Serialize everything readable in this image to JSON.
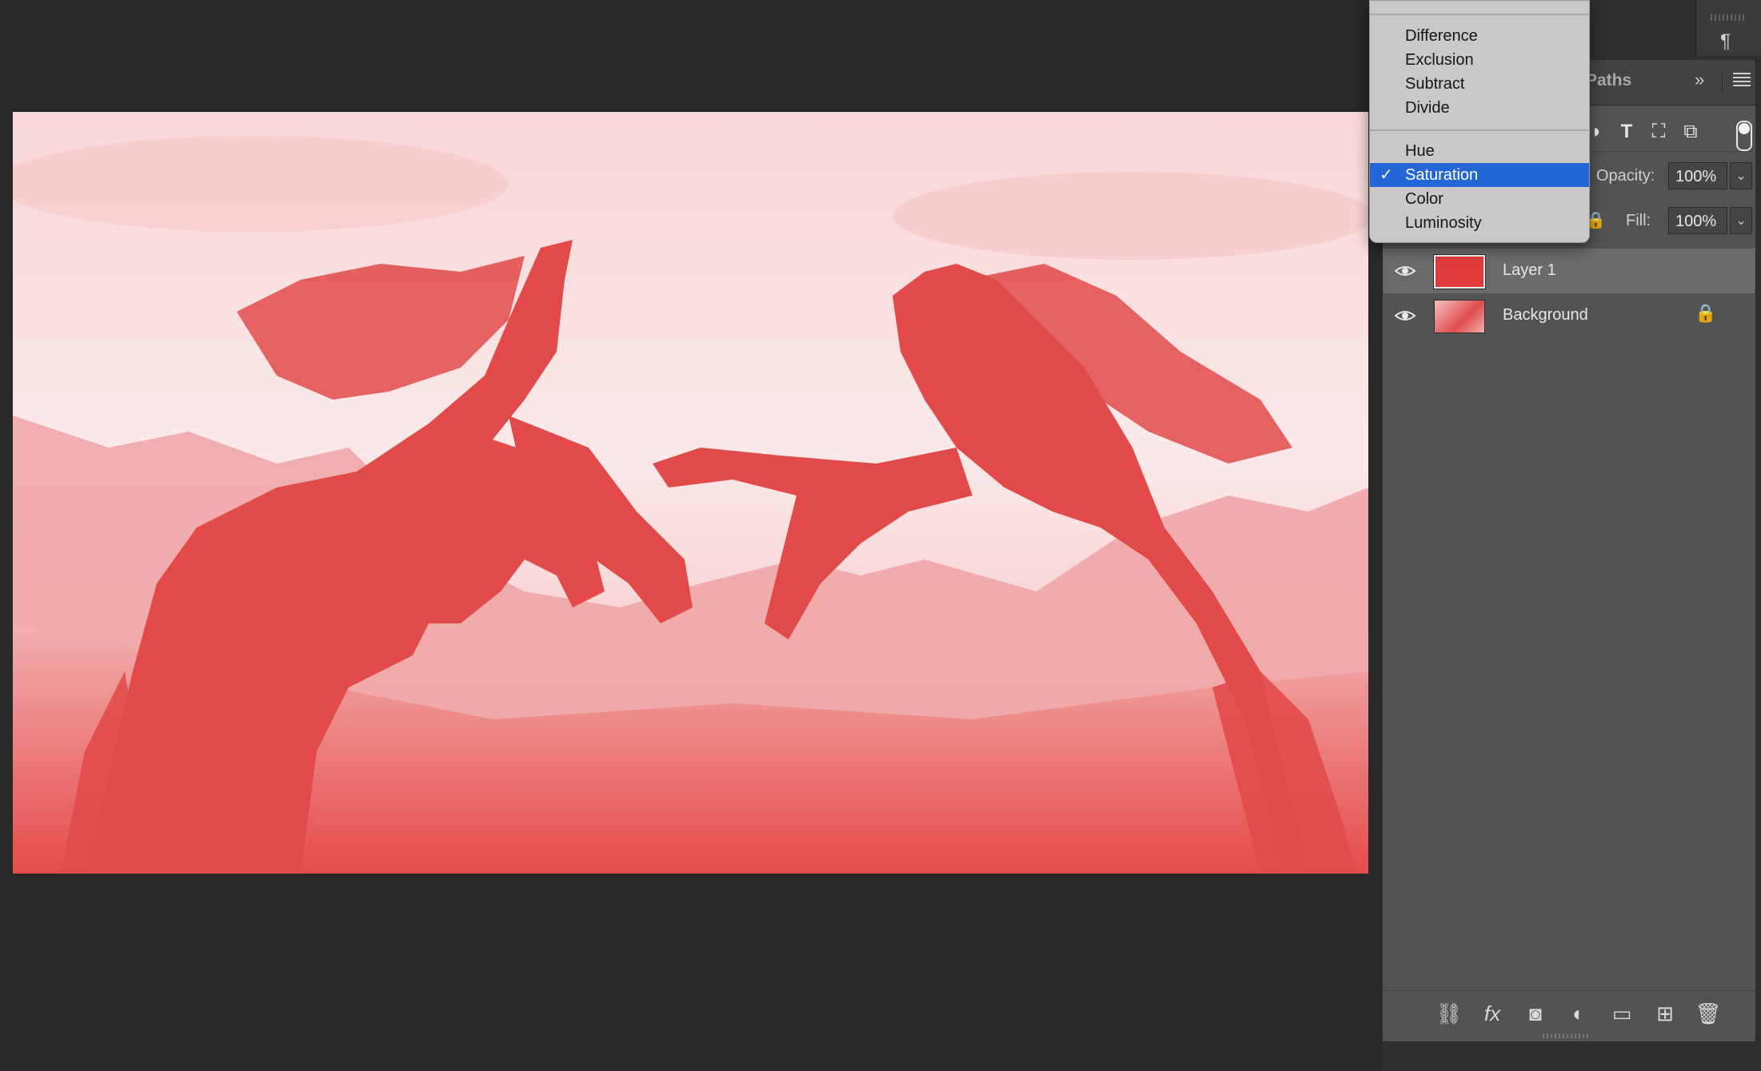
{
  "canvas": {
    "background": "#282828",
    "image_tint": "#e64848"
  },
  "panel_tabs": {
    "paths_label": "Paths",
    "expand_glyph": "»",
    "menu_icon": "hamburger-icon"
  },
  "blend_menu": {
    "groups": [
      [
        "Difference",
        "Exclusion",
        "Subtract",
        "Divide"
      ],
      [
        "Hue",
        "Saturation",
        "Color",
        "Luminosity"
      ]
    ],
    "items": {
      "difference": "Difference",
      "exclusion": "Exclusion",
      "subtract": "Subtract",
      "divide": "Divide",
      "hue": "Hue",
      "saturation": "Saturation",
      "color": "Color",
      "luminosity": "Luminosity"
    },
    "selected": "Saturation",
    "check_glyph": "✓",
    "highlight_color": "#2566d6"
  },
  "layers_controls": {
    "opacity_label": "Opacity:",
    "opacity_value": "100%",
    "fill_label": "Fill:",
    "fill_value": "100%",
    "dropdown_glyph": "⌄"
  },
  "layers": [
    {
      "name": "Layer 1",
      "visible": true,
      "selected": true,
      "locked": false,
      "thumb_color": "#e03a3a"
    },
    {
      "name": "Background",
      "visible": true,
      "selected": false,
      "locked": true
    }
  ],
  "footer_icons": [
    "link-icon",
    "fx-icon",
    "mask-icon",
    "adjustment-icon",
    "folder-icon",
    "new-layer-icon",
    "trash-icon"
  ],
  "footer_labels": {
    "fx": "fx"
  }
}
